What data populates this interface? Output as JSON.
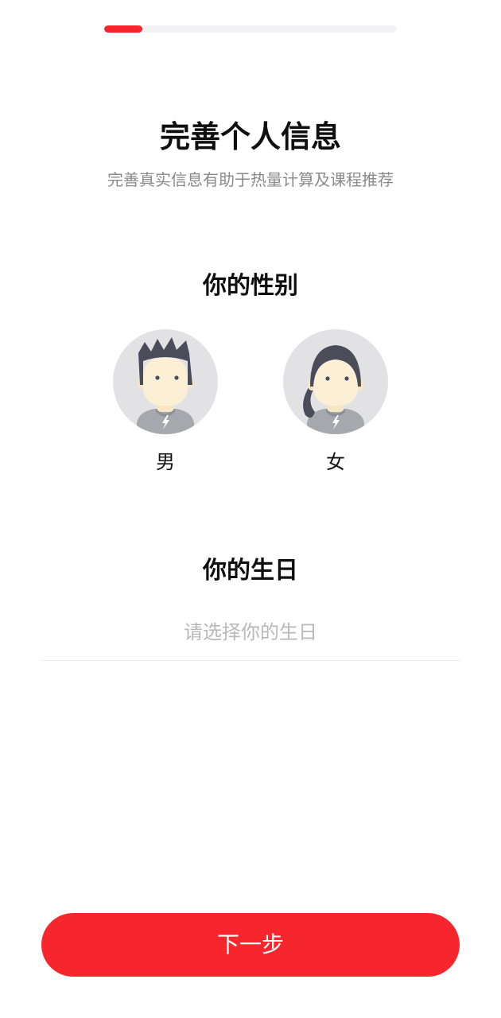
{
  "progress": {
    "fraction": 0.13,
    "fill_color": "#f7262c",
    "track_color": "#f2f2f4"
  },
  "header": {
    "title": "完善个人信息",
    "subtitle": "完善真实信息有助于热量计算及课程推荐"
  },
  "gender": {
    "title": "你的性别",
    "options": [
      {
        "label": "男",
        "avatar_icon": "male-avatar-icon"
      },
      {
        "label": "女",
        "avatar_icon": "female-avatar-icon"
      }
    ]
  },
  "birthday": {
    "title": "你的生日",
    "placeholder": "请选择你的生日"
  },
  "footer": {
    "next_label": "下一步",
    "button_color": "#f7262c"
  }
}
